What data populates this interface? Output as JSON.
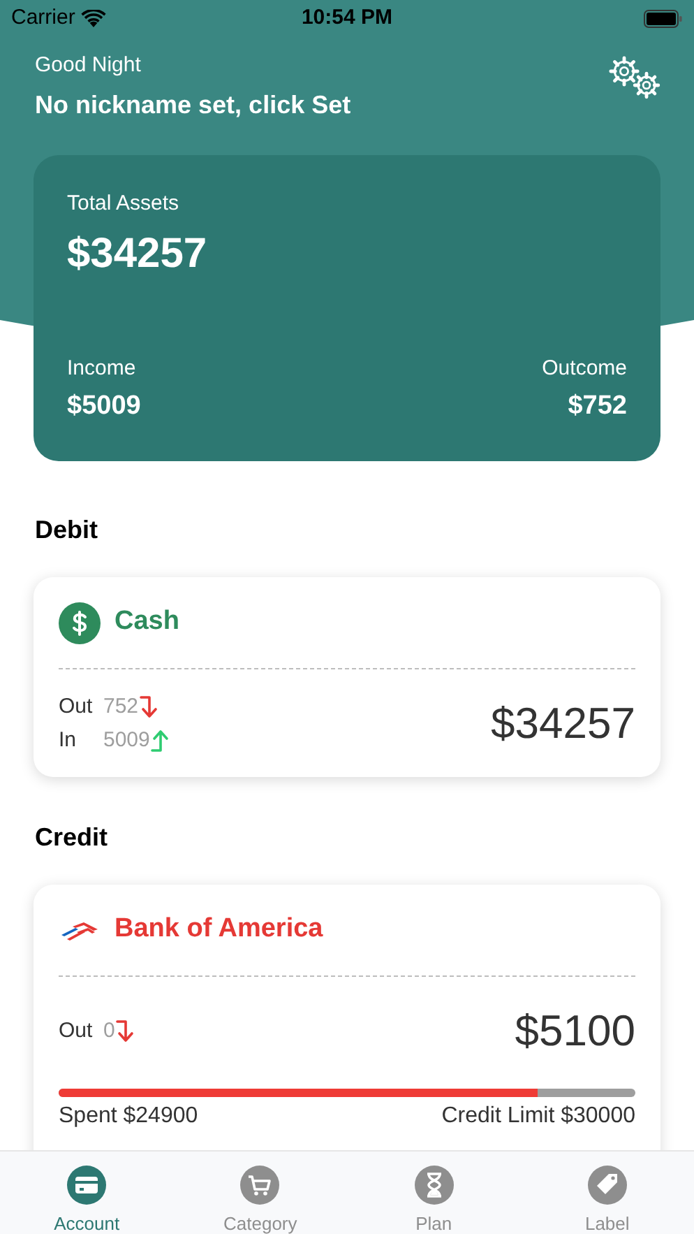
{
  "status_bar": {
    "carrier": "Carrier",
    "time": "10:54 PM"
  },
  "header": {
    "greeting": "Good Night",
    "nickname": "No nickname set, click Set"
  },
  "summary": {
    "total_label": "Total Assets",
    "total": "$34257",
    "income_label": "Income",
    "income": "$5009",
    "outcome_label": "Outcome",
    "outcome": "$752"
  },
  "sections": [
    {
      "title": "Debit",
      "accounts": [
        {
          "kind": "cash",
          "name": "Cash",
          "color": "#2e8b5c",
          "out_label": "Out",
          "out": "752",
          "in_label": "In",
          "in": "5009",
          "balance": "$34257"
        }
      ]
    },
    {
      "title": "Credit",
      "accounts": [
        {
          "kind": "credit",
          "name": "Bank of America",
          "color": "#e53935",
          "out_label": "Out",
          "out": "0",
          "balance": "$5100",
          "level": 0.83,
          "spent": "Spent $24900",
          "limit": "Credit Limit $30000"
        }
      ]
    }
  ],
  "tabs": [
    {
      "label": "Account",
      "selected": true
    },
    {
      "label": "Category",
      "selected": false
    },
    {
      "label": "Plan",
      "selected": false
    },
    {
      "label": "Label",
      "selected": false
    }
  ]
}
